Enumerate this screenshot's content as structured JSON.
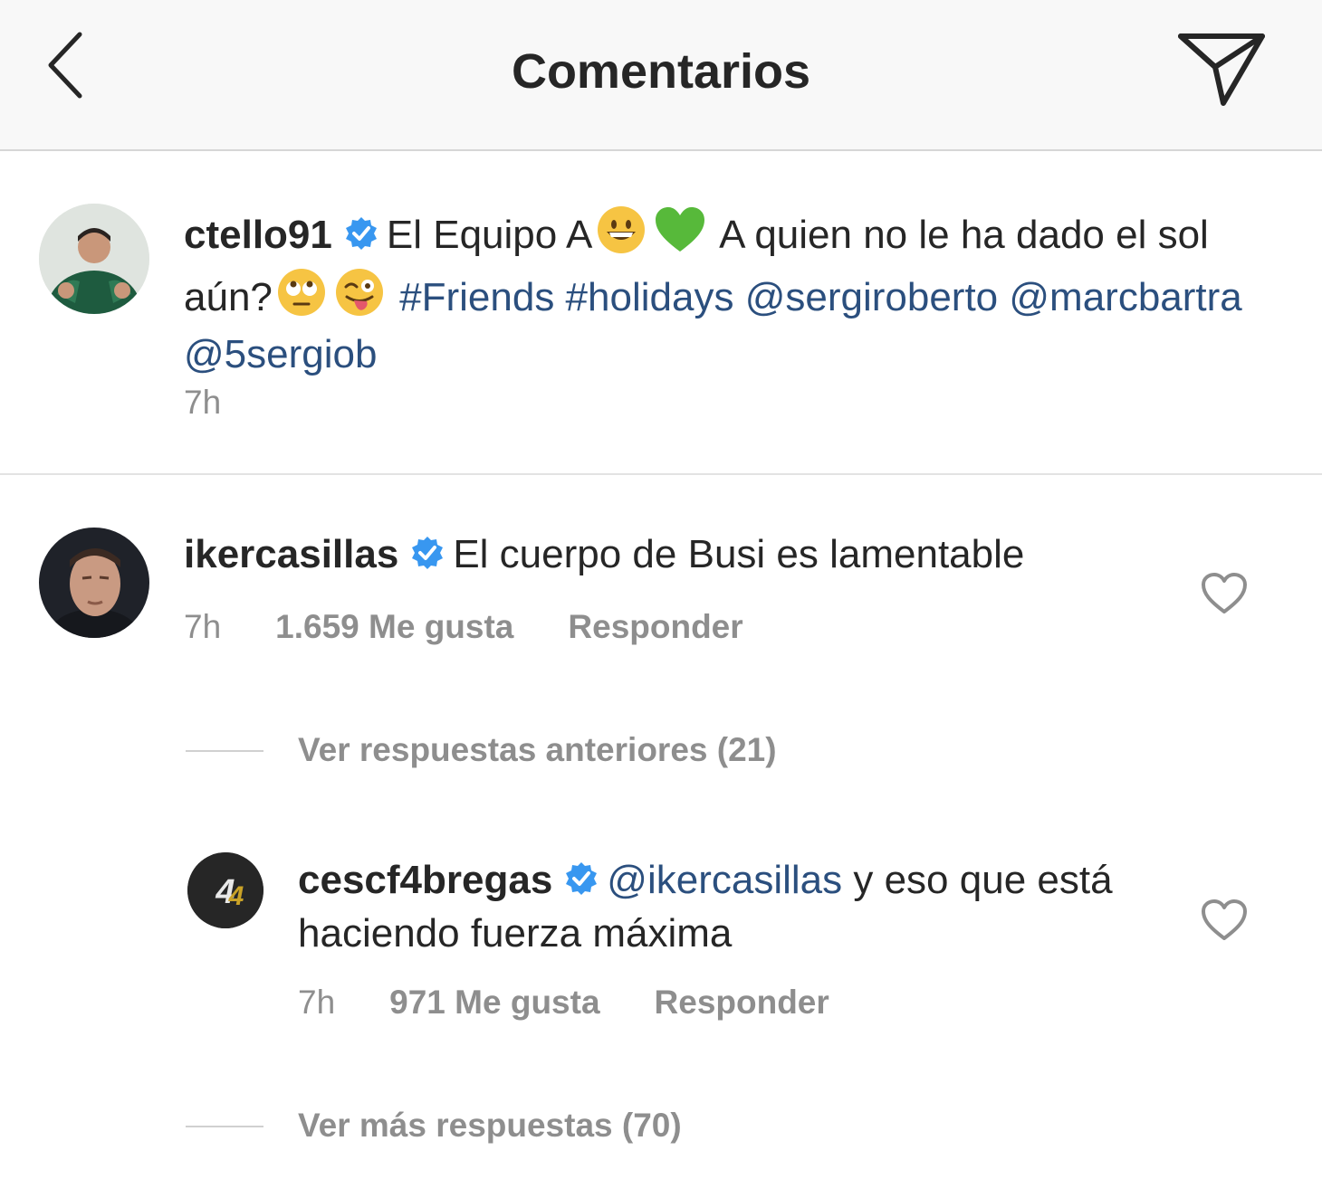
{
  "header": {
    "title": "Comentarios",
    "back_icon": "chevron-left-icon",
    "share_icon": "paper-plane-icon"
  },
  "caption": {
    "username": "ctello91",
    "text_1": "El Equipo A",
    "text_2": " A quien no le ha dado el sol aún?",
    "hashtag_1": "#Friends",
    "hashtag_2": "#holidays",
    "mention_1": "@sergiroberto",
    "mention_2": "@marcbartra",
    "mention_3": "@5sergiob",
    "time": "7h"
  },
  "comment": {
    "username": "ikercasillas",
    "text": "El cuerpo de Busi es lamentable",
    "time": "7h",
    "likes": "1.659 Me gusta",
    "reply": "Responder"
  },
  "view_previous": "Ver respuestas anteriores (21)",
  "reply": {
    "username": "cescf4bregas",
    "mention": "@ikercasillas",
    "text": " y eso que está haciendo fuerza máxima",
    "time": "7h",
    "likes": "971 Me gusta",
    "reply": "Responder"
  },
  "view_more": "Ver más respuestas (70)",
  "colors": {
    "link": "#2b4f7e",
    "verified": "#3897f0",
    "muted": "#8e8e8e",
    "header_bg": "#f8f8f8"
  }
}
